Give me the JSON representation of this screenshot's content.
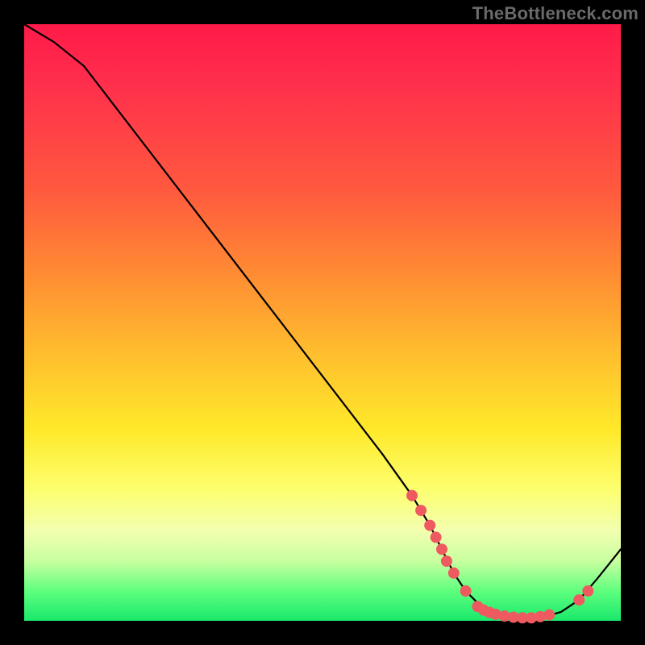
{
  "watermark": "TheBottleneck.com",
  "colors": {
    "background": "#000000",
    "gradient_top": "#ff1a49",
    "gradient_bottom": "#19e86b",
    "line": "#000000",
    "marker": "#ee5a60"
  },
  "chart_data": {
    "type": "line",
    "title": "",
    "xlabel": "",
    "ylabel": "",
    "xlim": [
      0,
      100
    ],
    "ylim": [
      0,
      100
    ],
    "series": [
      {
        "name": "bottleneck-curve",
        "x": [
          0,
          5,
          10,
          20,
          30,
          40,
          50,
          60,
          65,
          68,
          70,
          72,
          74,
          76,
          78,
          80,
          82,
          84,
          86,
          88,
          90,
          93,
          96,
          100
        ],
        "y": [
          100,
          97,
          93,
          80,
          67,
          54,
          41,
          28,
          21,
          16,
          12,
          8,
          5,
          3,
          1.5,
          0.8,
          0.5,
          0.5,
          0.6,
          0.9,
          1.5,
          3.5,
          7,
          12
        ]
      }
    ],
    "markers": [
      {
        "x": 65.0,
        "y": 21.0
      },
      {
        "x": 66.5,
        "y": 18.5
      },
      {
        "x": 68.0,
        "y": 16.0
      },
      {
        "x": 69.0,
        "y": 14.0
      },
      {
        "x": 70.0,
        "y": 12.0
      },
      {
        "x": 70.8,
        "y": 10.0
      },
      {
        "x": 72.0,
        "y": 8.0
      },
      {
        "x": 74.0,
        "y": 5.0
      },
      {
        "x": 76.0,
        "y": 2.4
      },
      {
        "x": 77.0,
        "y": 1.8
      },
      {
        "x": 78.0,
        "y": 1.4
      },
      {
        "x": 79.0,
        "y": 1.1
      },
      {
        "x": 80.5,
        "y": 0.8
      },
      {
        "x": 82.0,
        "y": 0.6
      },
      {
        "x": 83.5,
        "y": 0.5
      },
      {
        "x": 85.0,
        "y": 0.5
      },
      {
        "x": 86.5,
        "y": 0.7
      },
      {
        "x": 88.0,
        "y": 1.0
      },
      {
        "x": 93.0,
        "y": 3.5
      },
      {
        "x": 94.5,
        "y": 5.0
      }
    ]
  }
}
